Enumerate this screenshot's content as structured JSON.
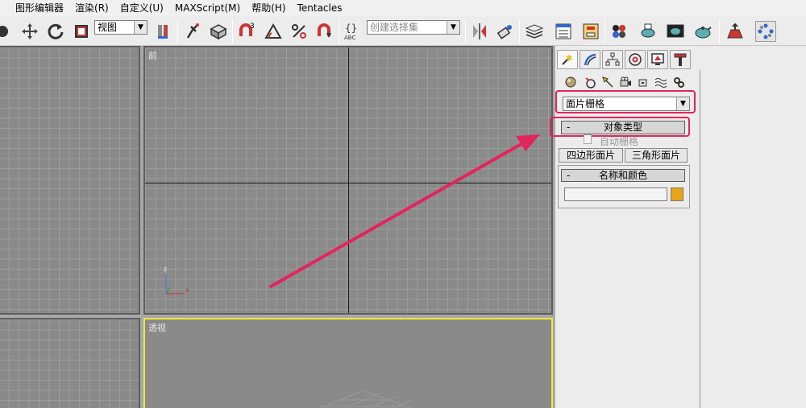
{
  "menu": [
    "图形编辑器",
    "渲染(R)",
    "自定义(U)",
    "MAXScript(M)",
    "帮助(H)",
    "Tentacles"
  ],
  "toolbar": {
    "view_dropdown": "视图",
    "selection_set_placeholder": "创建选择集",
    "snap_3_label": "3",
    "abc_label": "ABC"
  },
  "viewports": {
    "front_label": "前",
    "perspective_label": "透视",
    "axis_z": "z",
    "axis_x": "x"
  },
  "panel": {
    "category_dropdown": "面片栅格",
    "object_type_header": "对象类型",
    "auto_grid_label": "自动栅格",
    "quad_patch_button": "四边形面片",
    "tri_patch_button": "三角形面片",
    "name_color_header": "名称和颜色",
    "name_value": "",
    "color_swatch": "#e8a317",
    "rollout_minus": "-"
  },
  "colors": {
    "highlight": "#e4245e",
    "perspective_border": "#f2e53c"
  }
}
